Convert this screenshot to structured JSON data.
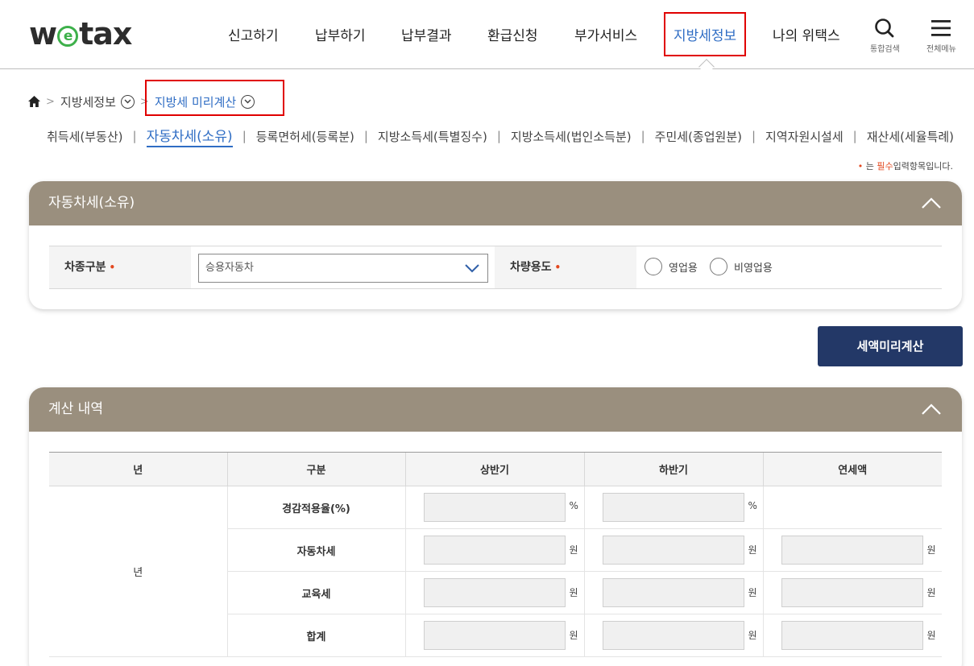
{
  "header": {
    "logo": {
      "w": "w",
      "e": "e",
      "tax": "tax"
    },
    "nav": [
      "신고하기",
      "납부하기",
      "납부결과",
      "환급신청",
      "부가서비스",
      "지방세정보",
      "나의 위택스"
    ],
    "search_label": "통합검색",
    "menu_label": "전체메뉴"
  },
  "breadcrumb": {
    "level1": "지방세정보",
    "level2": "지방세 미리계산"
  },
  "subtabs": [
    "취득세(부동산)",
    "자동차세(소유)",
    "등록면허세(등록분)",
    "지방소득세(특별징수)",
    "지방소득세(법인소득분)",
    "주민세(종업원분)",
    "지역자원시설세",
    "재산세(세율특례)"
  ],
  "required_note": {
    "dot": "•",
    "pre": "는",
    "must": "필수",
    "post": "입력항목입니다."
  },
  "form_panel": {
    "title": "자동차세(소유)",
    "vehicle_type_label": "차종구분",
    "vehicle_type_value": "승용자동차",
    "usage_label": "차량용도",
    "required_mark": "•",
    "usage_options": [
      "영업용",
      "비영업용"
    ]
  },
  "calc_button": "세액미리계산",
  "result_panel": {
    "title": "계산 내역",
    "columns": [
      "년",
      "구분",
      "상반기",
      "하반기",
      "연세액"
    ],
    "year_cell": "년",
    "rows": [
      {
        "label": "경감적용율(%)",
        "unit": "%"
      },
      {
        "label": "자동차세",
        "unit": "원"
      },
      {
        "label": "교육세",
        "unit": "원"
      },
      {
        "label": "합계",
        "unit": "원"
      }
    ]
  }
}
